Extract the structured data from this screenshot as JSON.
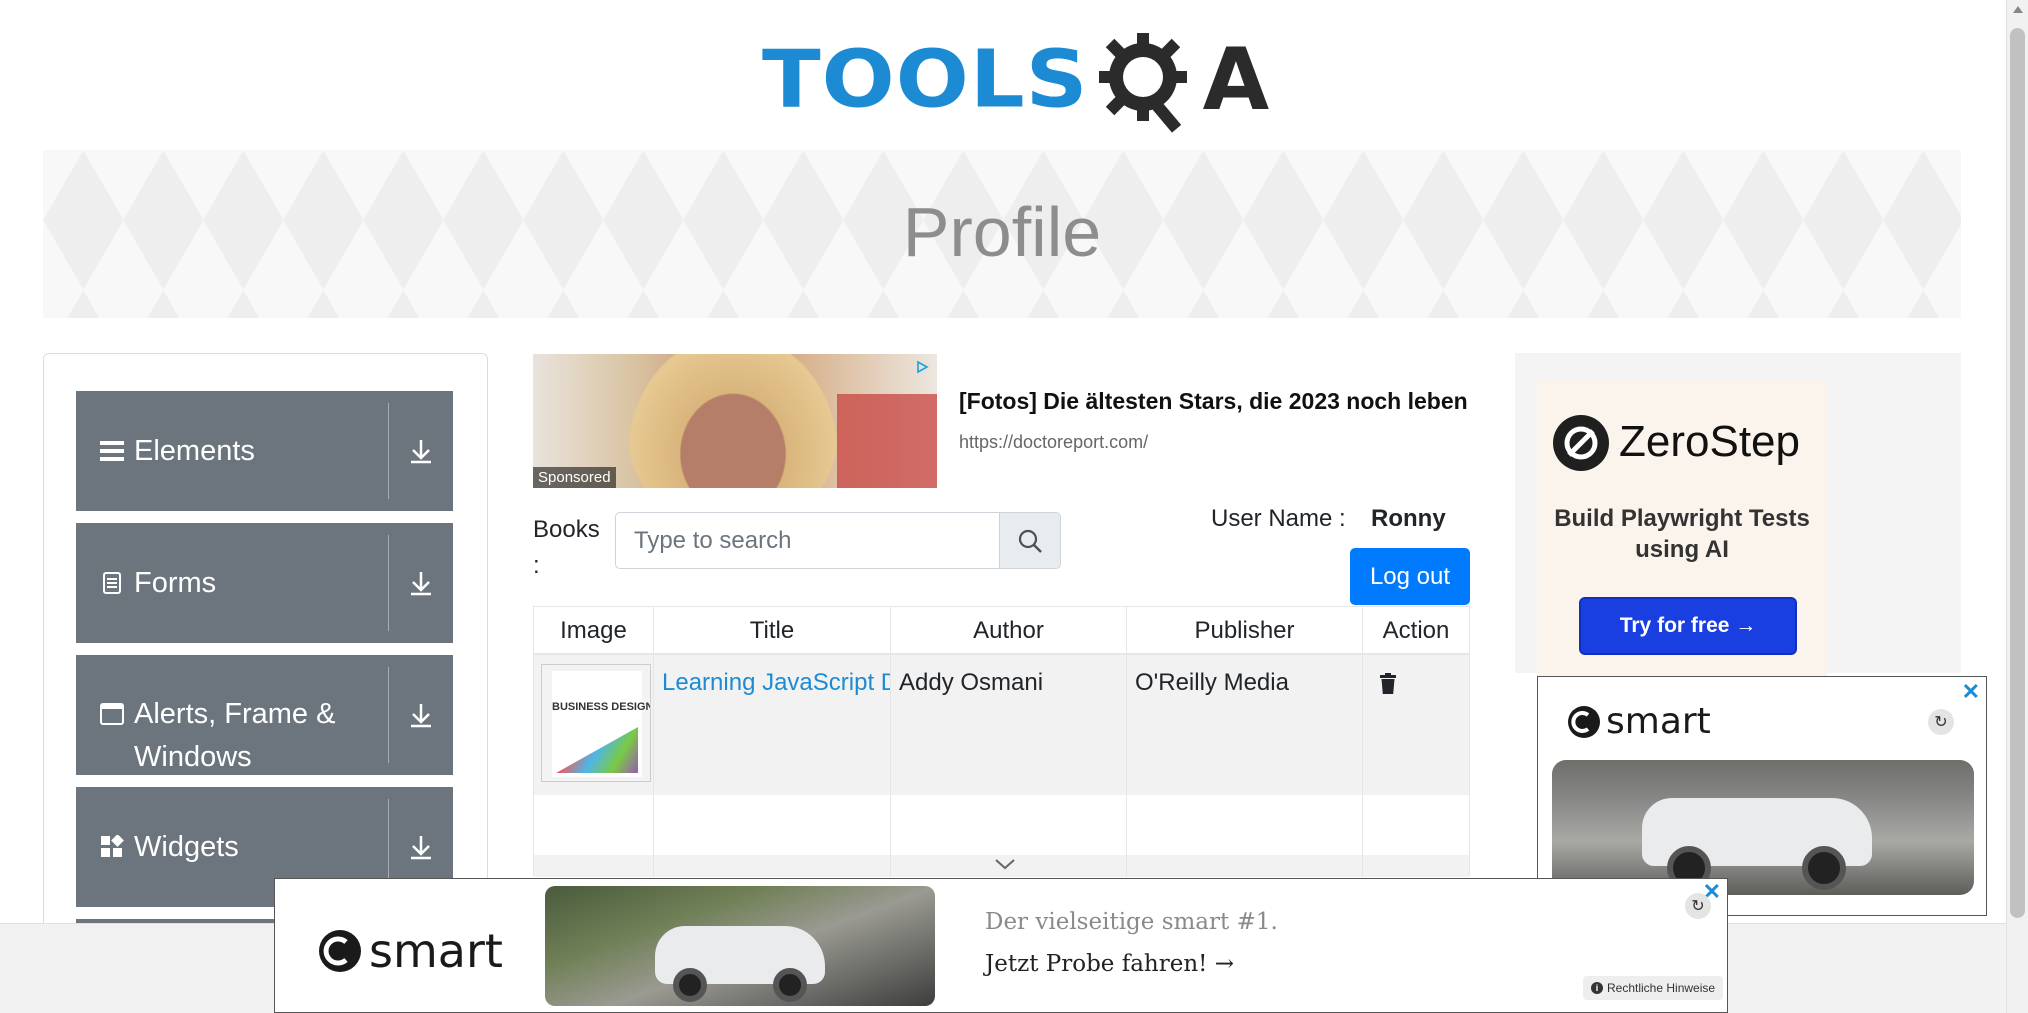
{
  "header": {
    "logo_text": "TOOLSQA"
  },
  "banner": {
    "title": "Profile"
  },
  "sidebar": {
    "groups": [
      {
        "label": "Elements",
        "icon": "hamburger-icon"
      },
      {
        "label": "Forms",
        "icon": "document-icon"
      },
      {
        "label": "Alerts, Frame & Windows",
        "icon": "window-icon"
      },
      {
        "label": "Widgets",
        "icon": "widgets-icon"
      }
    ]
  },
  "center_ad": {
    "sponsored": "Sponsored",
    "headline": "[Fotos] Die ältesten Stars, die 2023 noch leben",
    "url": "https://doctoreport.com/"
  },
  "books": {
    "label": "Books :",
    "search_placeholder": "Type to search"
  },
  "user": {
    "label": "User Name :",
    "name": "Ronny",
    "logout_label": "Log out"
  },
  "table": {
    "headers": [
      "Image",
      "Title",
      "Author",
      "Publisher",
      "Action"
    ],
    "rows": [
      {
        "title": "Learning JavaScript Design Patterns",
        "author": "Addy Osmani",
        "publisher": "O'Reilly Media",
        "cover_title": "BUSINESS DESIGN"
      }
    ]
  },
  "right_ad": {
    "brand": "ZeroStep",
    "subtitle": "Build Playwright Tests using AI",
    "cta": "Try for free →"
  },
  "smart_ad_right": {
    "brand": "smart"
  },
  "smart_ad_bottom": {
    "brand": "smart",
    "line1": "Der vielseitige smart #1.",
    "line2": "Jetzt Probe fahren! →",
    "legal": "Rechtliche Hinweise"
  },
  "colors": {
    "accent": "#007bff",
    "sidebar_group": "#6c757d",
    "logo_blue": "#1d8bd3"
  }
}
